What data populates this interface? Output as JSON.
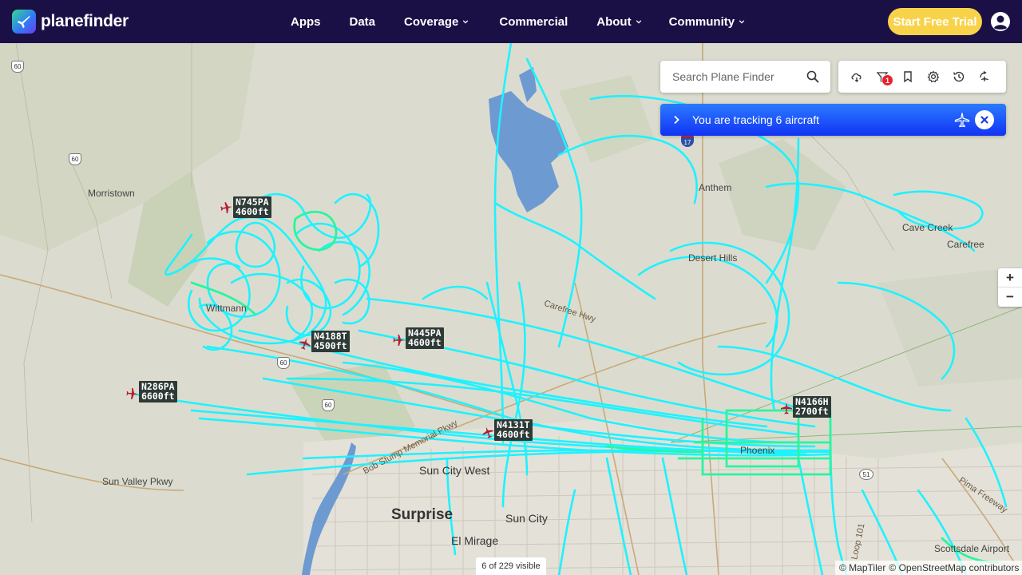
{
  "header": {
    "brand": "planefinder",
    "nav": [
      {
        "label": "Apps",
        "dropdown": false
      },
      {
        "label": "Data",
        "dropdown": false
      },
      {
        "label": "Coverage",
        "dropdown": true
      },
      {
        "label": "Commercial",
        "dropdown": false
      },
      {
        "label": "About",
        "dropdown": true
      },
      {
        "label": "Community",
        "dropdown": true
      }
    ],
    "trial_button": "Start Free Trial"
  },
  "search": {
    "placeholder": "Search Plane Finder"
  },
  "toolbar": {
    "icons": [
      "weather-icon",
      "filter-icon",
      "bookmark-icon",
      "settings-icon",
      "history-icon",
      "playback-icon"
    ],
    "filter_badge": "1"
  },
  "tracking": {
    "text": "You are tracking 6 aircraft"
  },
  "zoom": {
    "in": "+",
    "out": "−"
  },
  "aircraft": [
    {
      "reg": "N745PA",
      "alt": "4600ft"
    },
    {
      "reg": "N4188T",
      "alt": "4500ft"
    },
    {
      "reg": "N445PA",
      "alt": "4600ft"
    },
    {
      "reg": "N286PA",
      "alt": "6600ft"
    },
    {
      "reg": "N4131T",
      "alt": "4600ft"
    },
    {
      "reg": "N4166H",
      "alt": "2700ft"
    }
  ],
  "places": {
    "morristown": "Morristown",
    "wittmann": "Wittmann",
    "anthem": "Anthem",
    "desert_hills": "Desert Hills",
    "cave_creek": "Cave Creek",
    "carefree": "Carefree",
    "sun_city_west": "Sun City West",
    "surprise": "Surprise",
    "sun_city": "Sun City",
    "el_mirage": "El Mirage",
    "phoenix": "Phoenix",
    "scottsdale_airport": "Scottsdale Airport"
  },
  "roads": {
    "sun_valley": "Sun Valley Pkwy",
    "carefree_hwy": "Carefree Hwy",
    "bell_road": "Bob Stump Memorial Pkwy",
    "pima": "Pima Freeway",
    "loop101": "Loop 101",
    "us60_a": "60",
    "us60_b": "60",
    "us60_c": "60",
    "us60_d": "60",
    "i17": "17",
    "sr51": "51"
  },
  "map_colors": {
    "track_primary": "#1ef2ff",
    "track_secondary": "#2af59e",
    "land": "#dcdcd0",
    "water": "#6e9ad2",
    "header": "#1a1046",
    "trial": "#f8d34a",
    "tracking_bar": "#1f5cf8"
  },
  "status": {
    "visible": "6 of 229 visible"
  },
  "attribution": {
    "maptiler": "© MapTiler",
    "osm": "© OpenStreetMap contributors"
  }
}
